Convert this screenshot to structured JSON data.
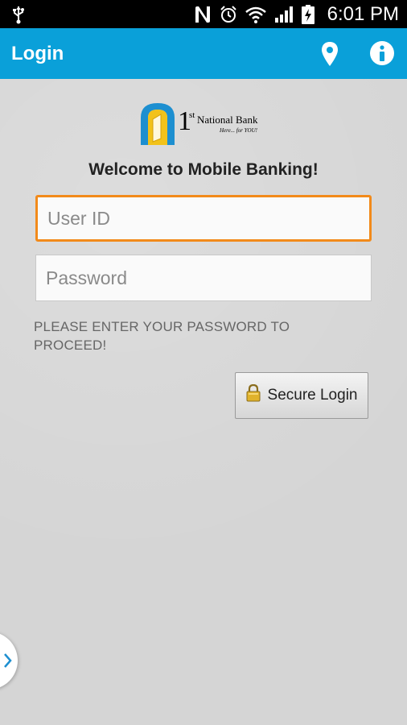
{
  "status_bar": {
    "time": "6:01 PM",
    "icons": [
      "usb-icon",
      "nfc-icon",
      "alarm-icon",
      "wifi-icon",
      "signal-icon",
      "battery-charging-icon"
    ]
  },
  "action_bar": {
    "title": "Login",
    "icons": [
      "location-pin-icon",
      "info-icon"
    ],
    "color": "#0aa0d9"
  },
  "logo": {
    "number": "1",
    "superscript": "st",
    "name": "National Bank",
    "tagline": "Here... for YOU!"
  },
  "welcome_text": "Welcome to Mobile Banking!",
  "form": {
    "user_id": {
      "value": "",
      "placeholder": "User ID"
    },
    "password": {
      "value": "",
      "placeholder": "Password"
    },
    "hint": "PLEASE ENTER YOUR PASSWORD TO PROCEED!",
    "submit_label": "Secure Login",
    "submit_icon": "lock-icon"
  },
  "drawer_handle": {
    "icon": "chevron-right-icon"
  },
  "colors": {
    "accent": "#0aa0d9",
    "focus": "#f28a1a"
  }
}
